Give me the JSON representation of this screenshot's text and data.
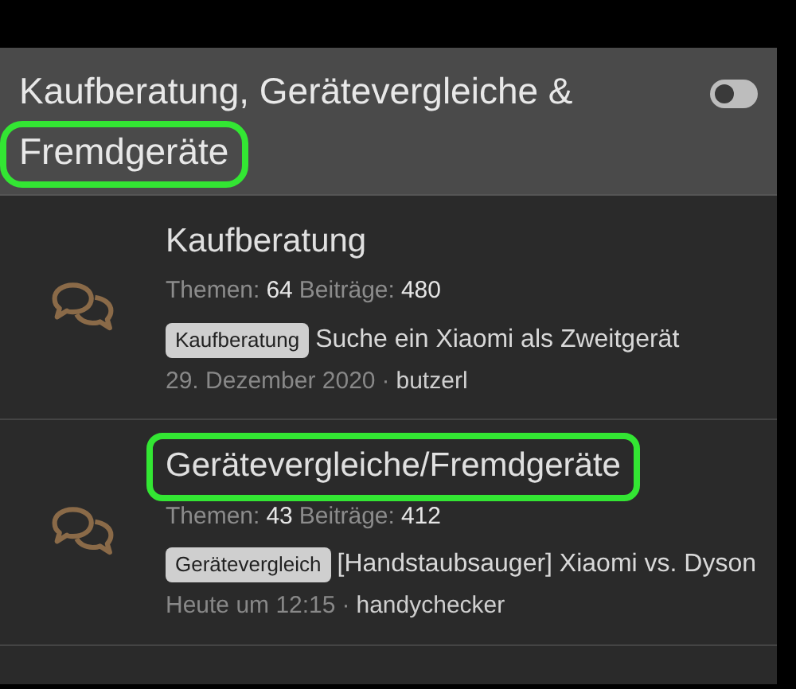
{
  "category": {
    "title_lines": [
      {
        "text": "Kaufberatung, Gerätevergleiche &",
        "highlighted": false
      },
      {
        "text": "Fremdgeräte",
        "highlighted": true
      }
    ],
    "toggle": {
      "on": false
    }
  },
  "forums": [
    {
      "title": "Kaufberatung",
      "highlighted": false,
      "stats": [
        {
          "label": "Themen:",
          "value": "64"
        },
        {
          "label": "Beiträge:",
          "value": "480"
        }
      ],
      "latest": {
        "tag": "Kaufberatung",
        "thread": "Suche ein Xiaomi als Zweitgerät",
        "date": "29. Dezember 2020",
        "separator": "·",
        "author": "butzerl"
      }
    },
    {
      "title": "Gerätevergleiche/Fremdgeräte",
      "highlighted": true,
      "stats": [
        {
          "label": "Themen:",
          "value": "43"
        },
        {
          "label": "Beiträge:",
          "value": "412"
        }
      ],
      "latest": {
        "tag": "Gerätevergleich",
        "thread": "[Handstaubsauger] Xiaomi vs. Dyson",
        "date": "Heute um 12:15",
        "separator": "·",
        "author": "handychecker"
      }
    }
  ]
}
